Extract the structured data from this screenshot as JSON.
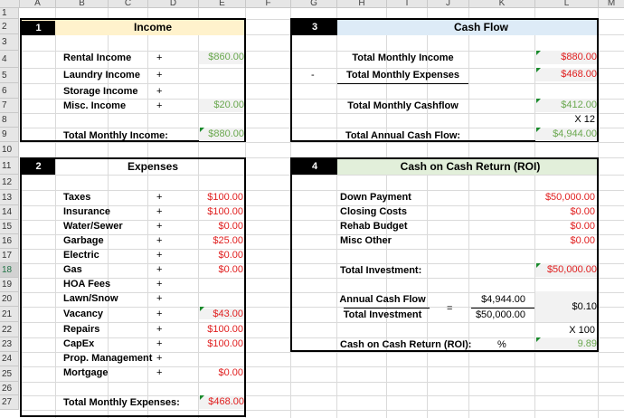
{
  "columns": [
    "A",
    "B",
    "C",
    "D",
    "E",
    "F",
    "G",
    "H",
    "I",
    "J",
    "K",
    "L",
    "M"
  ],
  "rows": [
    "1",
    "2",
    "3",
    "4",
    "5",
    "6",
    "7",
    "8",
    "9",
    "10",
    "11",
    "12",
    "13",
    "14",
    "15",
    "16",
    "17",
    "18",
    "19",
    "20",
    "21",
    "22",
    "23",
    "24",
    "25",
    "26",
    "27"
  ],
  "income": {
    "num": "1",
    "title": "Income",
    "items": [
      {
        "label": "Rental Income",
        "op": "+",
        "value": "$860.00"
      },
      {
        "label": "Laundry Income",
        "op": "+",
        "value": ""
      },
      {
        "label": "Storage Income",
        "op": "+",
        "value": ""
      },
      {
        "label": "Misc. Income",
        "op": "+",
        "value": "$20.00"
      }
    ],
    "total_label": "Total Monthly Income:",
    "total_value": "$880.00"
  },
  "cashflow": {
    "num": "3",
    "title": "Cash Flow",
    "total_income_label": "Total Monthly Income",
    "total_income_value": "$880.00",
    "minus": "-",
    "total_expenses_label": "Total Monthly Expenses",
    "total_expenses_value": "$468.00",
    "monthly_cf_label": "Total Monthly Cashflow",
    "monthly_cf_value": "$412.00",
    "multiplier": "X 12",
    "annual_label": "Total Annual Cash Flow:",
    "annual_value": "$4,944.00"
  },
  "expenses": {
    "num": "2",
    "title": "Expenses",
    "items": [
      {
        "label": "Taxes",
        "op": "+",
        "value": "$100.00"
      },
      {
        "label": "Insurance",
        "op": "+",
        "value": "$100.00"
      },
      {
        "label": "Water/Sewer",
        "op": "+",
        "value": "$0.00"
      },
      {
        "label": "Garbage",
        "op": "+",
        "value": "$25.00"
      },
      {
        "label": "Electric",
        "op": "+",
        "value": "$0.00"
      },
      {
        "label": "Gas",
        "op": "+",
        "value": "$0.00"
      },
      {
        "label": "HOA Fees",
        "op": "+",
        "value": ""
      },
      {
        "label": "Lawn/Snow",
        "op": "+",
        "value": ""
      },
      {
        "label": "Vacancy",
        "op": "+",
        "value": "$43.00"
      },
      {
        "label": "Repairs",
        "op": "+",
        "value": "$100.00"
      },
      {
        "label": "CapEx",
        "op": "+",
        "value": "$100.00"
      },
      {
        "label": "Prop. Management",
        "op": "+",
        "value": ""
      },
      {
        "label": "Mortgage",
        "op": "+",
        "value": "$0.00"
      }
    ],
    "total_label": "Total Monthly Expenses:",
    "total_value": "$468.00"
  },
  "roi": {
    "num": "4",
    "title": "Cash on Cash Return (ROI)",
    "items": [
      {
        "label": "Down Payment",
        "value": "$50,000.00"
      },
      {
        "label": "Closing Costs",
        "value": "$0.00"
      },
      {
        "label": "Rehab Budget",
        "value": "$0.00"
      },
      {
        "label": "Misc Other",
        "value": "$0.00"
      }
    ],
    "total_inv_label": "Total Investment:",
    "total_inv_value": "$50,000.00",
    "acf_label": "Annual Cash Flow",
    "acf_value": "$4,944.00",
    "eq": "=",
    "ti_label": "Total Investment",
    "ti_value": "$50,000.00",
    "ratio": "$0.10",
    "x100": "X 100",
    "coc_label": "Cash on Cash Return (ROI):",
    "pct": "%",
    "coc_value": "9.89"
  },
  "colors": {
    "income_header": "#fff2cc",
    "cashflow_header": "#ddebf7",
    "roi_header": "#e2efda",
    "red": "#e01e1e",
    "green": "#6aa84f"
  }
}
